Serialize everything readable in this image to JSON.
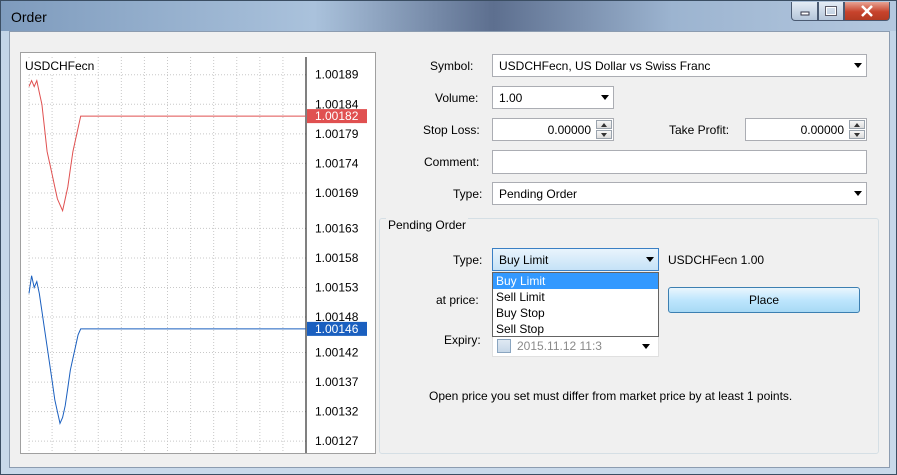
{
  "window": {
    "title": "Order"
  },
  "chart": {
    "symbol": "USDCHFecn",
    "bid_tag": "1.00182",
    "ask_tag": "1.00146",
    "bid_color": "#e05050",
    "ask_color": "#1a5fbf"
  },
  "chart_data": {
    "type": "line",
    "ylim": [
      1.00125,
      1.00192
    ],
    "yticks": [
      "1.00189",
      "1.00184",
      "1.00179",
      "1.00174",
      "1.00169",
      "1.00163",
      "1.00158",
      "1.00153",
      "1.00148",
      "1.00142",
      "1.00137",
      "1.00132",
      "1.00127"
    ],
    "grid": true,
    "series": [
      {
        "values": [
          1.00187,
          1.00188,
          1.00187,
          1.00188,
          1.00186,
          1.00184,
          1.0018,
          1.00176,
          1.00174,
          1.00172,
          1.0017,
          1.00168,
          1.00167,
          1.00166,
          1.00168,
          1.0017,
          1.00173,
          1.00176,
          1.00178,
          1.0018,
          1.00182,
          1.00182,
          1.00182,
          1.00182,
          1.00182
        ]
      },
      {
        "values": [
          1.00152,
          1.00155,
          1.00153,
          1.00154,
          1.00152,
          1.00149,
          1.00146,
          1.00143,
          1.0014,
          1.00137,
          1.00134,
          1.00132,
          1.0013,
          1.00131,
          1.00133,
          1.00136,
          1.00139,
          1.00141,
          1.00143,
          1.00145,
          1.00146,
          1.00146,
          1.00146,
          1.00146,
          1.00146
        ]
      }
    ]
  },
  "form": {
    "symbol_label": "Symbol:",
    "symbol_value": "USDCHFecn, US Dollar vs Swiss Franc",
    "volume_label": "Volume:",
    "volume_value": "1.00",
    "stop_loss_label": "Stop Loss:",
    "stop_loss_value": "0.00000",
    "take_profit_label": "Take Profit:",
    "take_profit_value": "0.00000",
    "comment_label": "Comment:",
    "comment_value": "",
    "type_label": "Type:",
    "type_value": "Pending Order"
  },
  "pending": {
    "group_title": "Pending Order",
    "type_label": "Type:",
    "type_value": "Buy Limit",
    "summary": "USDCHFecn 1.00",
    "options": [
      "Buy Limit",
      "Sell Limit",
      "Buy Stop",
      "Sell Stop"
    ],
    "at_price_label": "at price:",
    "place_label": "Place",
    "expiry_label": "Expiry:",
    "expiry_value": "2015.11.12 11:3",
    "note": "Open price you set must differ from market price by at least 1 points."
  }
}
